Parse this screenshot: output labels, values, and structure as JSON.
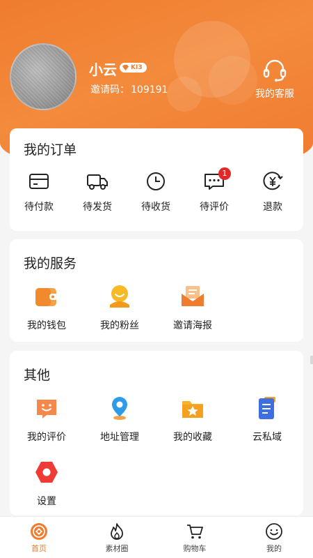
{
  "profile": {
    "name": "小云",
    "level": "KI3",
    "invite_label": "邀请码：",
    "invite_code": "109191",
    "service_label": "我的客服"
  },
  "orders": {
    "title": "我的订单",
    "items": [
      {
        "label": "待付款",
        "icon": "card-icon"
      },
      {
        "label": "待发货",
        "icon": "truck-icon"
      },
      {
        "label": "待收货",
        "icon": "clock-icon"
      },
      {
        "label": "待评价",
        "icon": "message-icon",
        "badge": "1"
      },
      {
        "label": "退款",
        "icon": "yen-icon"
      }
    ]
  },
  "services": {
    "title": "我的服务",
    "items": [
      {
        "label": "我的钱包",
        "icon": "wallet-icon"
      },
      {
        "label": "我的粉丝",
        "icon": "fans-icon"
      },
      {
        "label": "邀请海报",
        "icon": "envelope-icon"
      }
    ]
  },
  "others": {
    "title": "其他",
    "items": [
      {
        "label": "我的评价",
        "icon": "smile-chat-icon"
      },
      {
        "label": "地址管理",
        "icon": "location-pin-icon"
      },
      {
        "label": "我的收藏",
        "icon": "star-folder-icon"
      },
      {
        "label": "云私域",
        "icon": "document-icon"
      },
      {
        "label": "设置",
        "icon": "hexagon-settings-icon"
      }
    ]
  },
  "tabbar": {
    "items": [
      {
        "label": "首页",
        "icon": "home-icon",
        "active": true
      },
      {
        "label": "素材圈",
        "icon": "flame-icon"
      },
      {
        "label": "购物车",
        "icon": "cart-icon"
      },
      {
        "label": "我的",
        "icon": "smile-face-icon"
      }
    ]
  },
  "colors": {
    "accent": "#f07c2e",
    "badge_red": "#e02a2a"
  }
}
